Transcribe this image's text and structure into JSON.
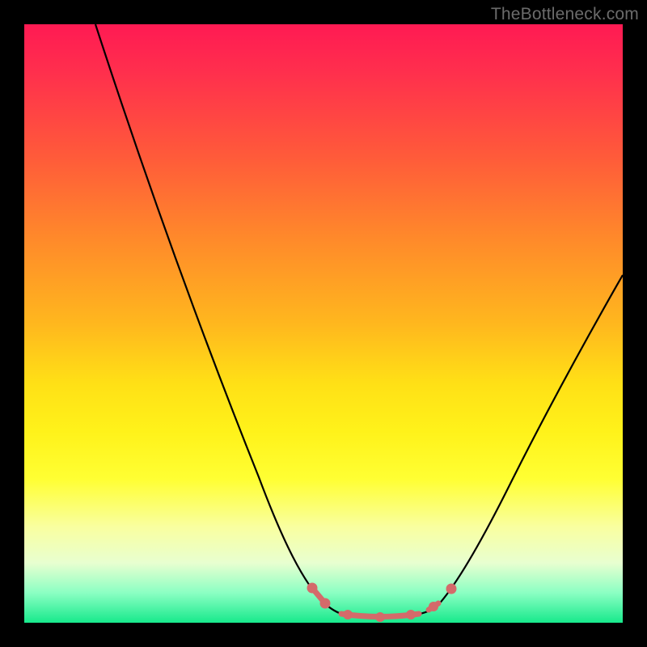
{
  "watermark": "TheBottleneck.com",
  "colors": {
    "background": "#000000",
    "curve": "#000000",
    "beads": "#d46a6a",
    "gradient_top": "#ff1a53",
    "gradient_bottom": "#17e98c"
  },
  "chart_data": {
    "type": "line",
    "title": "",
    "xlabel": "",
    "ylabel": "",
    "xlim": [
      0,
      100
    ],
    "ylim": [
      0,
      100
    ],
    "series": [
      {
        "name": "left-curve",
        "x": [
          12,
          18,
          24,
          30,
          36,
          42,
          46,
          48,
          50,
          52
        ],
        "y": [
          100,
          82,
          63,
          45,
          28,
          14,
          6,
          3,
          1.5,
          1
        ]
      },
      {
        "name": "bottom-segment",
        "x": [
          52,
          56,
          60,
          64,
          68
        ],
        "y": [
          1,
          0.8,
          0.8,
          1,
          1.5
        ]
      },
      {
        "name": "right-curve",
        "x": [
          68,
          72,
          76,
          82,
          88,
          94,
          100
        ],
        "y": [
          1.5,
          4,
          10,
          22,
          36,
          48,
          58
        ]
      }
    ],
    "annotations": [
      {
        "name": "bead-left-upper",
        "x": 48,
        "y": 3.5
      },
      {
        "name": "bead-left-lower",
        "x": 50,
        "y": 1.8
      },
      {
        "name": "bead-bottom-1",
        "x": 54,
        "y": 1.0
      },
      {
        "name": "bead-bottom-2",
        "x": 59,
        "y": 0.9
      },
      {
        "name": "bead-bottom-3",
        "x": 64,
        "y": 1.1
      },
      {
        "name": "bead-right-lower",
        "x": 68,
        "y": 1.8
      },
      {
        "name": "bead-right-upper",
        "x": 71,
        "y": 4.5
      }
    ]
  }
}
